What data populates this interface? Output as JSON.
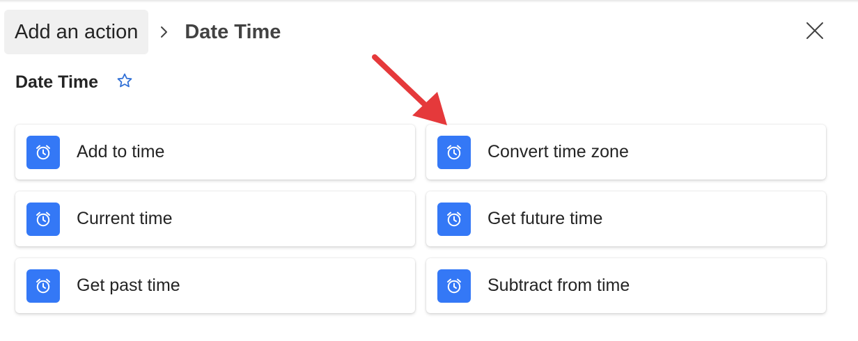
{
  "colors": {
    "accent": "#3478f6",
    "icon_bg": "#3478f6",
    "annotation_arrow": "#e5393b",
    "star": "#2f6fd6"
  },
  "breadcrumb": {
    "back_label": "Add an action",
    "separator_icon": "chevron-right-icon",
    "current_label": "Date Time"
  },
  "header": {
    "close_icon": "close-icon"
  },
  "section": {
    "title": "Date Time",
    "favorite_icon": "star-outline-icon"
  },
  "actions": [
    {
      "label": "Add to time",
      "icon": "alarm-clock-icon"
    },
    {
      "label": "Convert time zone",
      "icon": "alarm-clock-icon"
    },
    {
      "label": "Current time",
      "icon": "alarm-clock-icon"
    },
    {
      "label": "Get future time",
      "icon": "alarm-clock-icon"
    },
    {
      "label": "Get past time",
      "icon": "alarm-clock-icon"
    },
    {
      "label": "Subtract from time",
      "icon": "alarm-clock-icon"
    }
  ],
  "annotation": {
    "icon": "red-arrow-icon"
  }
}
